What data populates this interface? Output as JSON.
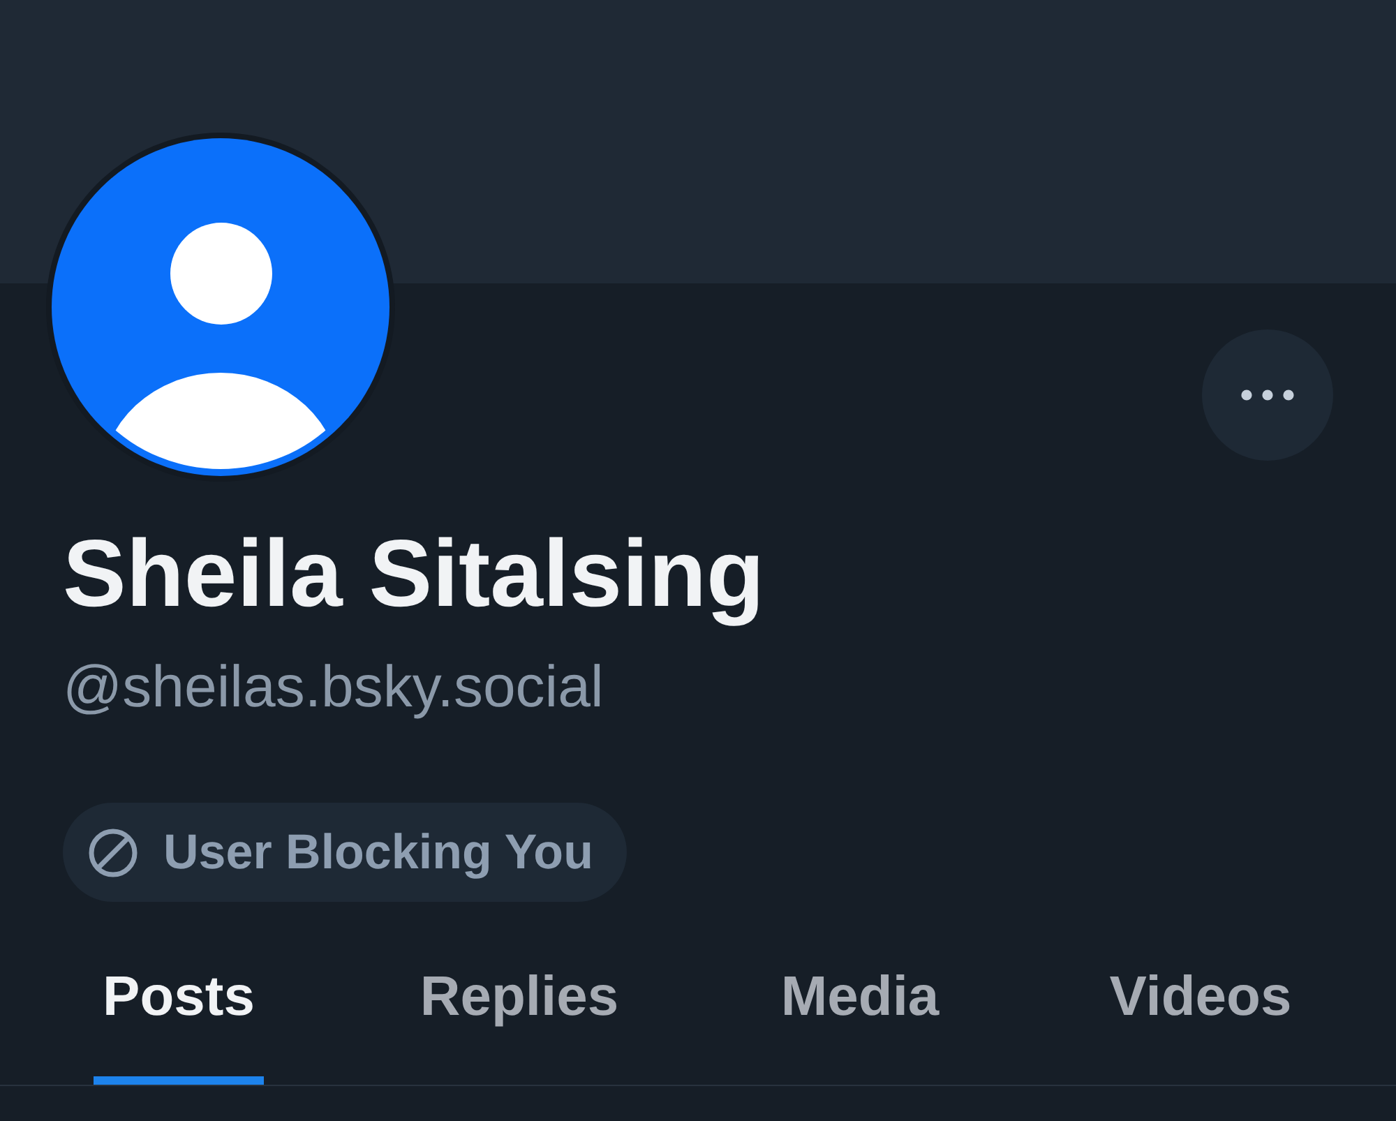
{
  "profile": {
    "display_name": "Sheila Sitalsing",
    "handle": "@sheilas.bsky.social"
  },
  "badge": {
    "label": "User Blocking You"
  },
  "tabs": [
    {
      "label": "Posts",
      "selected": true
    },
    {
      "label": "Replies",
      "selected": false
    },
    {
      "label": "Media",
      "selected": false
    },
    {
      "label": "Videos",
      "selected": false
    }
  ]
}
